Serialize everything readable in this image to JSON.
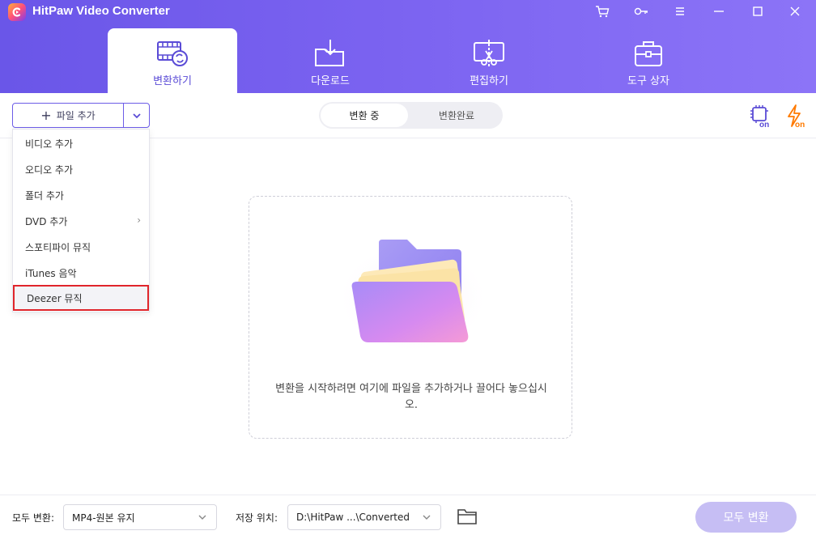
{
  "window": {
    "title": "HitPaw Video Converter"
  },
  "tabs": [
    {
      "label": "변환하기",
      "icon": "film-convert-icon",
      "active": true
    },
    {
      "label": "다운로드",
      "icon": "download-folder-icon",
      "active": false
    },
    {
      "label": "편집하기",
      "icon": "edit-scissors-icon",
      "active": false
    },
    {
      "label": "도구 상자",
      "icon": "toolbox-icon",
      "active": false
    }
  ],
  "toolbar": {
    "add_file_label": "파일 추가",
    "segments": [
      "변환 중",
      "변환완료"
    ],
    "active_segment": "변환 중"
  },
  "add_menu": {
    "items": [
      {
        "label": "비디오 추가",
        "has_submenu": false
      },
      {
        "label": "오디오 추가",
        "has_submenu": false
      },
      {
        "label": "폴더 추가",
        "has_submenu": false
      },
      {
        "label": "DVD 추가",
        "has_submenu": true
      },
      {
        "label": "스포티파이 뮤직",
        "has_submenu": false
      },
      {
        "label": "iTunes 음악",
        "has_submenu": false
      },
      {
        "label": "Deezer 뮤직",
        "has_submenu": false,
        "highlighted": true
      }
    ]
  },
  "dropzone": {
    "hint": "변환을 시작하려면 여기에 파일을 추가하거나 끌어다 놓으십시오."
  },
  "footer": {
    "convert_all_label": "모두 변환:",
    "format_value": "MP4-원본 유지",
    "save_label": "저장 위치:",
    "save_path": "D:\\HitPaw ...\\Converted",
    "convert_button": "모두 변환"
  },
  "colors": {
    "header_start": "#6a56e8",
    "header_end": "#8c74f7",
    "accent": "#6c5ce7",
    "highlight_border": "#e0252b",
    "convert_button_disabled": "#c6bef4"
  }
}
